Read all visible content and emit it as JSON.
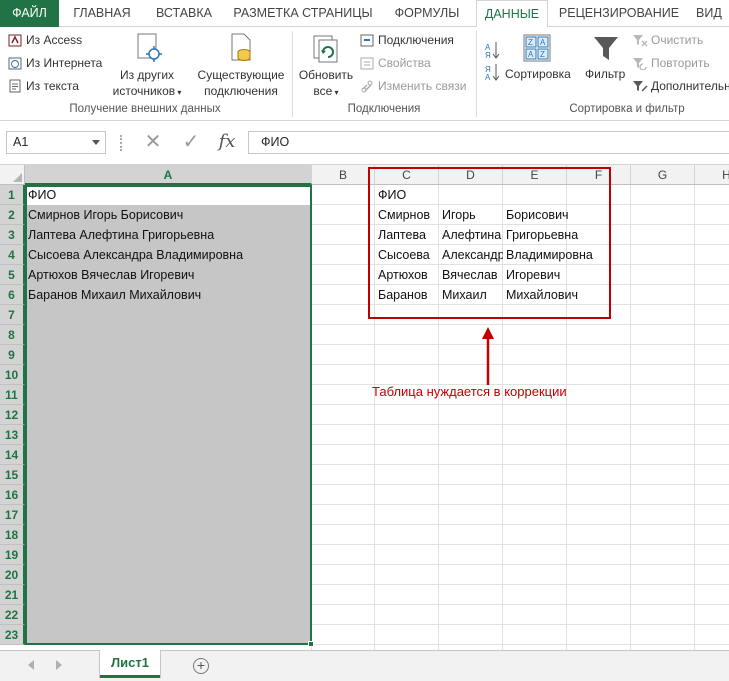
{
  "tabs": [
    {
      "label": "ФАЙЛ"
    },
    {
      "label": "ГЛАВНАЯ"
    },
    {
      "label": "ВСТАВКА"
    },
    {
      "label": "РАЗМЕТКА СТРАНИЦЫ"
    },
    {
      "label": "ФОРМУЛЫ"
    },
    {
      "label": "ДАННЫЕ"
    },
    {
      "label": "РЕЦЕНЗИРОВАНИЕ"
    },
    {
      "label": "ВИД"
    }
  ],
  "ribbon": {
    "external": {
      "from_access": "Из Access",
      "from_web": "Из Интернета",
      "from_text": "Из текста",
      "from_other_1": "Из других",
      "from_other_2": "источников",
      "existing_1": "Существующие",
      "existing_2": "подключения",
      "group_label": "Получение внешних данных"
    },
    "connections": {
      "refresh_1": "Обновить",
      "refresh_2": "все",
      "connections": "Подключения",
      "properties": "Свойства",
      "edit_links": "Изменить связи",
      "group_label": "Подключения"
    },
    "sort_filter": {
      "sort": "Сортировка",
      "filter": "Фильтр",
      "clear": "Очистить",
      "reapply": "Повторить",
      "advanced": "Дополнительно",
      "group_label": "Сортировка и фильтр"
    }
  },
  "formula_bar": {
    "name_box": "A1",
    "content": "ФИО"
  },
  "columns": [
    "A",
    "B",
    "C",
    "D",
    "E",
    "F",
    "G",
    "H"
  ],
  "rows": [
    "1",
    "2",
    "3",
    "4",
    "5",
    "6",
    "7",
    "8",
    "9",
    "10",
    "11",
    "12",
    "13",
    "14",
    "15",
    "16",
    "17",
    "18",
    "19",
    "20",
    "21",
    "22",
    "23"
  ],
  "column_a": [
    "ФИО",
    "Смирнов Игорь Борисович",
    "Лаптева Алефтина Григорьевна",
    "Сысоева Александра Владимировна",
    "Артюхов Вячеслав Игоревич",
    "Баранов Михаил Михайлович"
  ],
  "split_table": [
    [
      "ФИО",
      "",
      ""
    ],
    [
      "Смирнов",
      "Игорь",
      "Борисович"
    ],
    [
      "Лаптева",
      "Алефтина",
      "Григорьевна"
    ],
    [
      "Сысоева",
      "Александра",
      "Владимировна"
    ],
    [
      "Артюхов",
      "Вячеслав",
      "Игоревич"
    ],
    [
      "Баранов",
      "Михаил",
      "Михайлович"
    ]
  ],
  "annotation": "Таблица нуждается в коррекции",
  "colors": {
    "excel_green": "#217346",
    "annotation_red": "#c00000"
  },
  "sheets": {
    "active": "Лист1",
    "add": "+"
  }
}
